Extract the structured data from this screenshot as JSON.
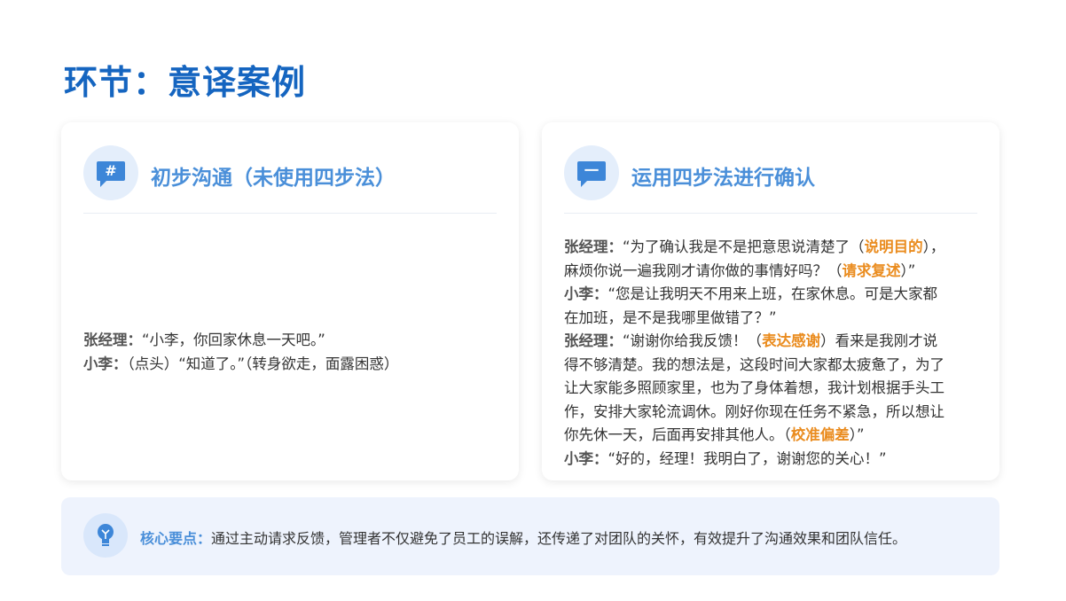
{
  "title": "环节：意译案例",
  "cards": [
    {
      "title": "初步沟通（未使用四步法）",
      "icon": "hashtag-chat-icon",
      "lines": [
        {
          "speaker": "张经理：",
          "parts": [
            {
              "text": "“小李，你回家休息一天吧。”",
              "hl": false
            }
          ]
        },
        {
          "speaker": "小李：",
          "parts": [
            {
              "text": "（点头）“知道了。”（转身欲走，面露困惑）",
              "hl": false
            }
          ]
        }
      ]
    },
    {
      "title": "运用四步法进行确认",
      "icon": "chat-bubble-icon",
      "lines": [
        {
          "speaker": "张经理：",
          "parts": [
            {
              "text": "“为了确认我是不是把意思说清楚了（",
              "hl": false
            },
            {
              "text": "说明目的",
              "hl": true
            },
            {
              "text": "），",
              "hl": false
            }
          ]
        },
        {
          "speaker": "",
          "parts": [
            {
              "text": "麻烦你说一遍我刚才请你做的事情好吗？（",
              "hl": false
            },
            {
              "text": "请求复述",
              "hl": true
            },
            {
              "text": "）”",
              "hl": false
            }
          ]
        },
        {
          "speaker": "小李：",
          "parts": [
            {
              "text": "“您是让我明天不用来上班，在家休息。可是大家都",
              "hl": false
            }
          ]
        },
        {
          "speaker": "",
          "parts": [
            {
              "text": "在加班，是不是我哪里做错了？”",
              "hl": false
            }
          ]
        },
        {
          "speaker": "张经理：",
          "parts": [
            {
              "text": "“谢谢你给我反馈！（",
              "hl": false
            },
            {
              "text": "表达感谢",
              "hl": true
            },
            {
              "text": "）看来是我刚才说",
              "hl": false
            }
          ]
        },
        {
          "speaker": "",
          "parts": [
            {
              "text": "得不够清楚。我的想法是，这段时间大家都太疲惫了，为了",
              "hl": false
            }
          ]
        },
        {
          "speaker": "",
          "parts": [
            {
              "text": "让大家能多照顾家里，也为了身体着想，我计划根据手头工",
              "hl": false
            }
          ]
        },
        {
          "speaker": "",
          "parts": [
            {
              "text": "作，安排大家轮流调休。刚好你现在任务不紧急，所以想让",
              "hl": false
            }
          ]
        },
        {
          "speaker": "",
          "parts": [
            {
              "text": "你先休一天，后面再安排其他人。（",
              "hl": false
            },
            {
              "text": "校准偏差",
              "hl": true
            },
            {
              "text": "）”",
              "hl": false
            }
          ]
        },
        {
          "speaker": "小李：",
          "parts": [
            {
              "text": "“好的，经理！我明白了，谢谢您的关心！”",
              "hl": false
            }
          ]
        }
      ]
    }
  ],
  "keypoint": {
    "icon": "lightbulb-icon",
    "label": "核心要点：",
    "text": "通过主动请求反馈，管理者不仅避免了员工的误解，还传递了对团队的关怀，有效提升了沟通效果和团队信任。"
  },
  "colors": {
    "title": "#1565c0",
    "accent": "#4a8fd9",
    "highlight": "#ea8c1f",
    "keypoint_bg": "#eef3fd"
  }
}
